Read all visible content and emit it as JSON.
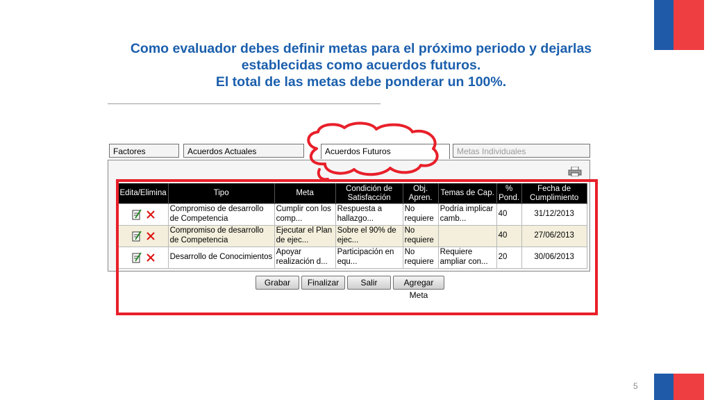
{
  "slide": {
    "title_lines": [
      "Como evaluador debes definir metas para el próximo periodo y dejarlas",
      "establecidas como acuerdos futuros.",
      "El total de las metas debe ponderar un 100%."
    ],
    "page_number": "5"
  },
  "colors": {
    "title": "#1b5fad",
    "highlight": "#e8202a",
    "flag_blue": "#1f5aa8",
    "flag_red": "#ef3e42"
  },
  "tabs": [
    {
      "label": "Factores",
      "state": "normal"
    },
    {
      "label": "Acuerdos Actuales",
      "state": "normal"
    },
    {
      "label": "Acuerdos Futuros",
      "state": "active"
    },
    {
      "label": "Metas Individuales",
      "state": "disabled"
    }
  ],
  "table": {
    "headers": [
      "Edita/Elimina",
      "Tipo",
      "Meta",
      "Condición de Satisfacción",
      "Obj. Apren.",
      "Temas de Cap.",
      "% Pond.",
      "Fecha de Cumplimiento"
    ],
    "rows": [
      {
        "tipo": "Compromiso de desarrollo de Competencia",
        "meta": "Cumplir con los comp...",
        "condicion": "Respuesta a hallazgo...",
        "obj": "No requiere",
        "temas": "Podría implicar camb...",
        "pond": "40",
        "fecha": "31/12/2013"
      },
      {
        "tipo": "Compromiso de desarrollo de Competencia",
        "meta": "Ejecutar el Plan de ejec...",
        "condicion": "Sobre el 90% de ejec...",
        "obj": "No requiere",
        "temas": "",
        "pond": "40",
        "fecha": "27/06/2013"
      },
      {
        "tipo": "Desarrollo de Conocimientos",
        "meta": "Apoyar realización d...",
        "condicion": "Participación en equ...",
        "obj": "No requiere",
        "temas": "Requiere ampliar con...",
        "pond": "20",
        "fecha": "30/06/2013"
      }
    ],
    "icons": {
      "edit": "edit-icon",
      "delete": "delete-icon",
      "print": "printer-icon"
    }
  },
  "buttons": {
    "save": "Grabar",
    "finish": "Finalizar",
    "exit": "Salir",
    "add": "Agregar Meta"
  }
}
